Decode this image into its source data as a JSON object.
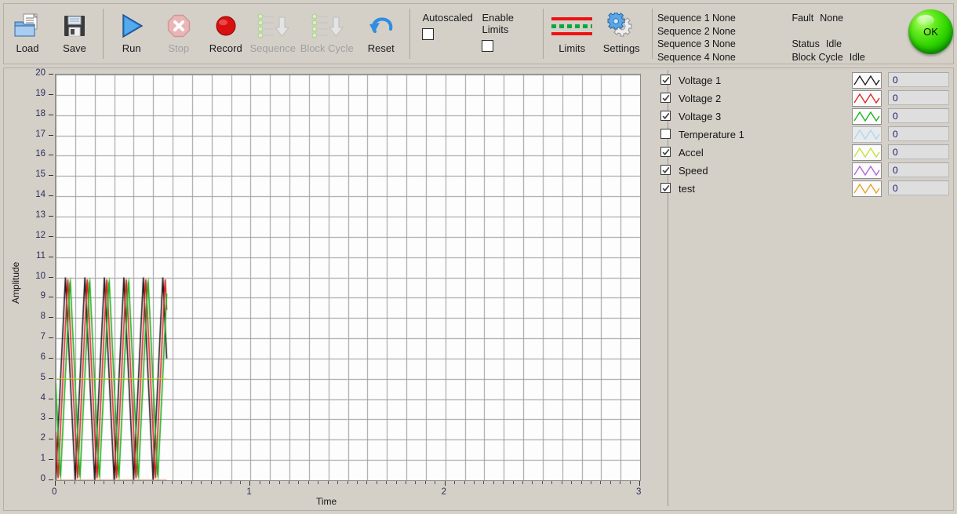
{
  "toolbar": {
    "buttons": [
      {
        "name": "load",
        "label": "Load",
        "icon": "folder-open-icon",
        "enabled": true
      },
      {
        "name": "save",
        "label": "Save",
        "icon": "floppy-disk-icon",
        "enabled": true
      },
      {
        "name": "run",
        "label": "Run",
        "icon": "play-triangle-icon",
        "enabled": true
      },
      {
        "name": "stop",
        "label": "Stop",
        "icon": "stop-octagon-icon",
        "enabled": false
      },
      {
        "name": "record",
        "label": "Record",
        "icon": "record-circle-icon",
        "enabled": true
      },
      {
        "name": "sequence",
        "label": "Sequence",
        "icon": "sequence-download-icon",
        "enabled": false
      },
      {
        "name": "block-cycle",
        "label": "Block Cycle",
        "icon": "block-cycle-download-icon",
        "enabled": false
      },
      {
        "name": "reset",
        "label": "Reset",
        "icon": "undo-arrow-icon",
        "enabled": true
      }
    ],
    "checkboxes": [
      {
        "name": "autoscaled",
        "label": "Autoscaled",
        "checked": false
      },
      {
        "name": "enable-limits",
        "label": "Enable Limits",
        "checked": false
      }
    ],
    "limits": {
      "label": "Limits",
      "icon": "limits-lines-icon"
    },
    "settings": {
      "label": "Settings",
      "icon": "gears-icon"
    }
  },
  "sequences": [
    {
      "label": "Sequence 1",
      "value": "None"
    },
    {
      "label": "Sequence 2",
      "value": "None"
    },
    {
      "label": "Sequence 3",
      "value": "None"
    },
    {
      "label": "Sequence 4",
      "value": "None"
    }
  ],
  "status": {
    "fault_label": "Fault",
    "fault_value": "None",
    "status_label": "Status",
    "status_value": "Idle",
    "block_cycle_label": "Block Cycle",
    "block_cycle_value": "Idle",
    "indicator_text": "OK",
    "indicator_color": "#2fd400"
  },
  "legend": {
    "channels": [
      {
        "name": "Voltage 1",
        "checked": true,
        "color": "#1a1a1a"
      },
      {
        "name": "Voltage 2",
        "checked": true,
        "color": "#e02020"
      },
      {
        "name": "Voltage 3",
        "checked": true,
        "color": "#18b018"
      },
      {
        "name": "Temperature 1",
        "checked": false,
        "color": "#a8d8f0"
      },
      {
        "name": "Accel",
        "checked": true,
        "color": "#c8e030"
      },
      {
        "name": "Speed",
        "checked": true,
        "color": "#b060d8"
      },
      {
        "name": "test",
        "checked": true,
        "color": "#e8a020"
      }
    ],
    "values": [
      "0",
      "0",
      "0",
      "0",
      "0",
      "0",
      "0"
    ]
  },
  "chart_data": {
    "type": "line",
    "title": "",
    "xlabel": "Time",
    "ylabel": "Amplitude",
    "xlim": [
      0,
      3
    ],
    "ylim": [
      0,
      20
    ],
    "xticks": [
      0,
      1,
      2,
      3
    ],
    "yticks": [
      0,
      1,
      2,
      3,
      4,
      5,
      6,
      7,
      8,
      9,
      10,
      11,
      12,
      13,
      14,
      15,
      16,
      17,
      18,
      19,
      20
    ],
    "grid": true,
    "legend_position": "right-panel",
    "data_x_extent": [
      0.0,
      0.57
    ],
    "series": [
      {
        "name": "Voltage 1",
        "color": "#1a1a1a",
        "visible": true,
        "waveform": "sawtooth",
        "amplitude_min": 0,
        "amplitude_max": 10,
        "period": 0.1,
        "phase": 0.0
      },
      {
        "name": "Voltage 2",
        "color": "#e02020",
        "visible": true,
        "waveform": "sawtooth",
        "amplitude_min": 0,
        "amplitude_max": 10,
        "period": 0.1,
        "phase": 0.012
      },
      {
        "name": "Voltage 3",
        "color": "#18b018",
        "visible": true,
        "waveform": "sawtooth",
        "amplitude_min": 0,
        "amplitude_max": 10,
        "period": 0.1,
        "phase": 0.024
      },
      {
        "name": "Temperature 1",
        "color": "#a8d8f0",
        "visible": false,
        "waveform": "none",
        "amplitude_min": 0,
        "amplitude_max": 0,
        "period": 0,
        "phase": 0
      },
      {
        "name": "Accel",
        "color": "#c8e030",
        "visible": true,
        "waveform": "constant",
        "amplitude_min": 5,
        "amplitude_max": 5,
        "period": 0,
        "phase": 0
      },
      {
        "name": "Speed",
        "color": "#b060d8",
        "visible": true,
        "waveform": "constant",
        "amplitude_min": 0,
        "amplitude_max": 0,
        "period": 0,
        "phase": 0
      },
      {
        "name": "test",
        "color": "#e8a020",
        "visible": true,
        "waveform": "constant",
        "amplitude_min": 0,
        "amplitude_max": 0,
        "period": 0,
        "phase": 0
      }
    ]
  }
}
